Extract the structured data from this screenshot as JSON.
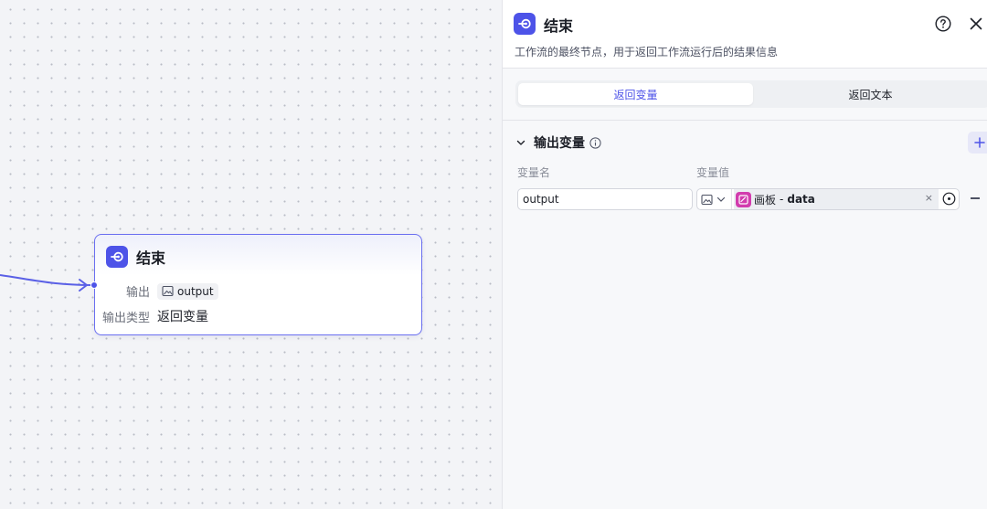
{
  "canvas": {
    "node": {
      "title": "结束",
      "output_label": "输出",
      "output_var": "output",
      "output_type_label": "输出类型",
      "output_type_value": "返回变量"
    }
  },
  "panel": {
    "title": "结束",
    "description": "工作流的最终节点，用于返回工作流运行后的结果信息",
    "tabs": [
      {
        "label": "返回变量",
        "active": true
      },
      {
        "label": "返回文本",
        "active": false
      }
    ],
    "section_title": "输出变量",
    "columns": {
      "name": "变量名",
      "value": "变量值"
    },
    "rows": [
      {
        "name": "output",
        "source": "画板",
        "separator": "-",
        "variable": "data",
        "clear": "×"
      }
    ]
  },
  "colors": {
    "accent": "#4d53e8",
    "node_border": "#6a6ff0",
    "ref_icon": "#d23cae"
  },
  "icons": [
    "end-node-icon",
    "image-icon",
    "help-icon",
    "close-icon",
    "chevron-down-icon",
    "info-icon",
    "plus-icon",
    "canvas-icon",
    "variable-picker-icon",
    "minus-icon"
  ]
}
